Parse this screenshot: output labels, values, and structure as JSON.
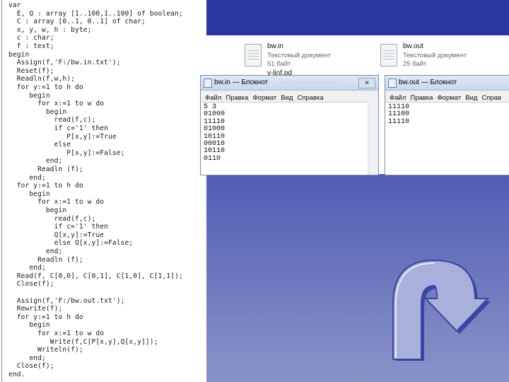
{
  "code": {
    "lines": [
      "var",
      "  E, Q : array [1..100,1..100] of boolean;",
      "  C : array [0..1, 0..1] of char;",
      "  x, y, w, h : byte;",
      "  c : char;",
      "  f : text;",
      "begin",
      "  Assign(f,'F:/bw.in.txt');",
      "  Reset(f);",
      "  Readln(f,w,h);",
      "  for y:=1 to h do",
      "     begin",
      "       for x:=1 to w do",
      "         begin",
      "           read(f,c);",
      "           if c='1' then",
      "              P[x,y]:=True",
      "           else",
      "              P[x,y]:=False;",
      "         end;",
      "       Readln (f);",
      "     end;",
      "  for y:=1 to h do",
      "     begin",
      "       for x:=1 to w do",
      "         begin",
      "           read(f,c);",
      "           if c='1' then",
      "           Q[x,y]:=True",
      "           else Q[x,y]:=False;",
      "         end;",
      "       Readln (f);",
      "     end;",
      "  Read(f, C[0,0], C[0,1], C[1,0], C[1,1]);",
      "  Close(f);",
      "",
      "  Assign(f,'F:/bw.out.txt');",
      "  Rewrite(f);",
      "  for y:=1 to h do",
      "     begin",
      "       for x:=1 to w do",
      "          Write(f,C[P[x,y],Q[x,y]]);",
      "       Writeln(f);",
      "     end;",
      "  Close(f);",
      "end."
    ]
  },
  "explorer": {
    "files": [
      {
        "name": "bw.in",
        "type": "Текстовый документ",
        "size": "51 байт"
      },
      {
        "name": "bw.out",
        "type": "Текстовый документ",
        "size": "25 байт"
      },
      {
        "name": "v-ljnf.pd"
      }
    ]
  },
  "notepad_in": {
    "title": "bw.in — Блокнот",
    "faint_title": "Текстовый документ",
    "menu": [
      "Файл",
      "Правка",
      "Формат",
      "Вид",
      "Справка"
    ],
    "content": [
      "5 3",
      "01000",
      "11110",
      "01000",
      "10110",
      "00010",
      "10110",
      "0110"
    ]
  },
  "notepad_out": {
    "title": "bw.out — Блокнот",
    "menu": [
      "Файл",
      "Правка",
      "Формат",
      "Вид",
      "Справ"
    ],
    "content": [
      "11110",
      "11100",
      "11110"
    ]
  },
  "colors": {
    "slide_top": "#2b36a0",
    "slide_bottom": "#8a93c8",
    "arrow_fill": "#aab0dc",
    "arrow_edge": "#3b45a2"
  },
  "icons": {
    "file": "text-document-icon",
    "arrow": "u-turn-arrow-icon"
  }
}
